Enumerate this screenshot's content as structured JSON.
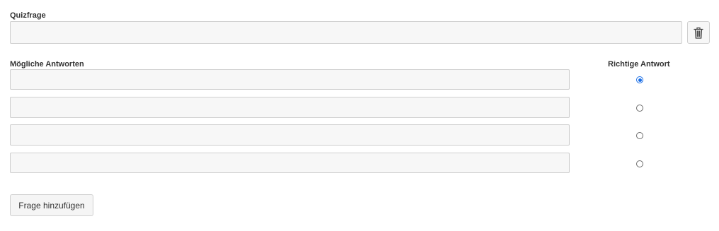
{
  "question": {
    "label": "Quizfrage",
    "value": "",
    "placeholder": "",
    "delete_icon": "trash-icon"
  },
  "answers": {
    "label": "Mögliche Antworten",
    "correct_label": "Richtige Antwort",
    "items": [
      {
        "value": "",
        "correct": true
      },
      {
        "value": "",
        "correct": false
      },
      {
        "value": "",
        "correct": false
      },
      {
        "value": "",
        "correct": false
      }
    ]
  },
  "add_question_label": "Frage hinzufügen",
  "colors": {
    "accent": "#1a6ee6",
    "input_bg": "#f7f7f7",
    "border": "#cfcfcf"
  }
}
